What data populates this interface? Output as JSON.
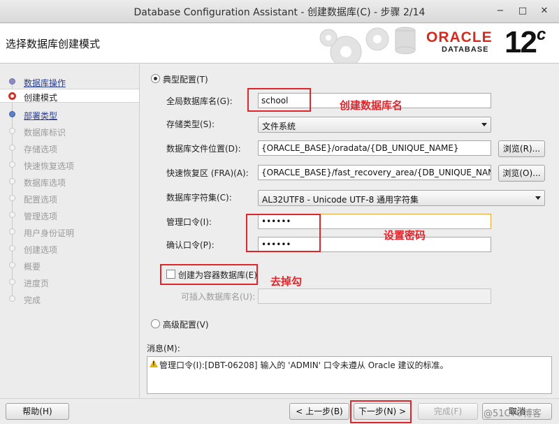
{
  "window": {
    "title": "Database Configuration Assistant - 创建数据库(C) - 步骤 2/14",
    "minimize": "−",
    "maximize": "□",
    "close": "✕"
  },
  "header": {
    "heading": "选择数据库创建模式",
    "brand": "ORACLE",
    "product": "DATABASE",
    "version": "12",
    "version_suffix": "c"
  },
  "steps": [
    {
      "label": "数据库操作",
      "state": "done"
    },
    {
      "label": "创建模式",
      "state": "current"
    },
    {
      "label": "部署类型",
      "state": "link"
    },
    {
      "label": "数据库标识",
      "state": "pending"
    },
    {
      "label": "存储选项",
      "state": "pending"
    },
    {
      "label": "快速恢复选项",
      "state": "pending"
    },
    {
      "label": "数据库选项",
      "state": "pending"
    },
    {
      "label": "配置选项",
      "state": "pending"
    },
    {
      "label": "管理选项",
      "state": "pending"
    },
    {
      "label": "用户身份证明",
      "state": "pending"
    },
    {
      "label": "创建选项",
      "state": "pending"
    },
    {
      "label": "概要",
      "state": "pending"
    },
    {
      "label": "进度页",
      "state": "pending"
    },
    {
      "label": "完成",
      "state": "pending"
    }
  ],
  "form": {
    "typical_label": "典型配置(T)",
    "typical_selected": true,
    "global_db_name_label": "全局数据库名(G):",
    "global_db_name_value": "school",
    "storage_type_label": "存储类型(S):",
    "storage_type_value": "文件系统",
    "db_file_location_label": "数据库文件位置(D):",
    "db_file_location_value": "{ORACLE_BASE}/oradata/{DB_UNIQUE_NAME}",
    "browse_r": "浏览(R)...",
    "fra_label": "快速恢复区 (FRA)(A):",
    "fra_value": "{ORACLE_BASE}/fast_recovery_area/{DB_UNIQUE_NAME}",
    "browse_o": "浏览(O)...",
    "charset_label": "数据库字符集(C):",
    "charset_value": "AL32UTF8 - Unicode UTF-8 通用字符集",
    "admin_pwd_label": "管理口令(I):",
    "admin_pwd_value": "••••••",
    "confirm_pwd_label": "确认口令(P):",
    "confirm_pwd_value": "••••••",
    "container_db_label": "创建为容器数据库(E)",
    "container_db_checked": false,
    "pluggable_db_label": "可插入数据库名(U):",
    "pluggable_db_value": "",
    "advanced_label": "高级配置(V)",
    "advanced_selected": false
  },
  "messages": {
    "label": "消息(M):",
    "text": "管理口令(I):[DBT-06208] 输入的 'ADMIN' 口令未遵从 Oracle 建议的标准。"
  },
  "annotations": {
    "db_name_note": "创建数据库名",
    "password_note": "设置密码",
    "uncheck_note": "去掉勾",
    "color": "#e0262c"
  },
  "footer": {
    "help": "帮助(H)",
    "back": "< 上一步(B)",
    "next": "下一步(N) >",
    "finish": "完成(F)",
    "cancel": "取消",
    "watermark": "@51CTO博客"
  }
}
